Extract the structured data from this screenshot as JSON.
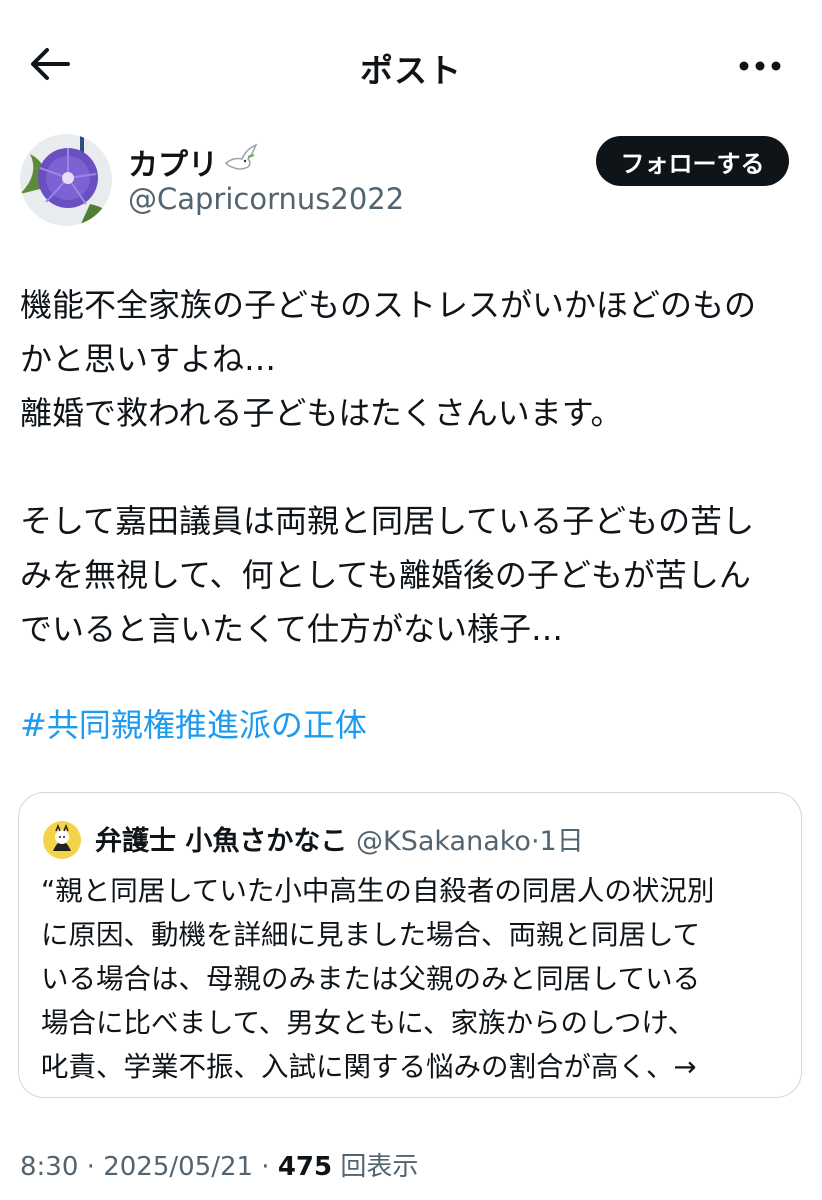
{
  "header": {
    "title": "ポスト"
  },
  "author": {
    "display_name": "カプリ",
    "handle": "@Capricornus2022",
    "follow_label": "フォローする"
  },
  "post": {
    "body": "機能不全家族の子どものストレスがいかほどのもの\nかと思いすよね…\n離婚で救われる子どもはたくさんいます。\n\nそして嘉田議員は両親と同居している子どもの苦し\nみを無視して、何としても離婚後の子どもが苦しん\nでいると言いたくて仕方がない様子…",
    "hashtag": "#共同親権推進派の正体"
  },
  "quote": {
    "name": "弁護士 小魚さかなこ",
    "handle": "@KSakanako",
    "separator": "·",
    "time": "1日",
    "text": "“親と同居していた小中高生の自殺者の同居人の状況別\nに原因、動機を詳細に見ました場合、両親と同居して\nいる場合は、母親のみまたは父親のみと同居している\n場合に比べまして、男女ともに、家族からのしつけ、\n叱責、学業不振、入試に関する悩みの割合が高く、→"
  },
  "meta": {
    "time": "8:30",
    "sep1": " · ",
    "date": "2025/05/21",
    "sep2": " · ",
    "views": "475",
    "views_label": " 回表示"
  },
  "icons": {
    "back": "back-arrow-icon",
    "more": "more-horizontal-icon",
    "dove": "dove-icon"
  },
  "colors": {
    "link": "#1d9bf0",
    "secondary_text": "#536471",
    "follow_button_bg": "#0f1419",
    "card_border": "#cfd9de"
  }
}
